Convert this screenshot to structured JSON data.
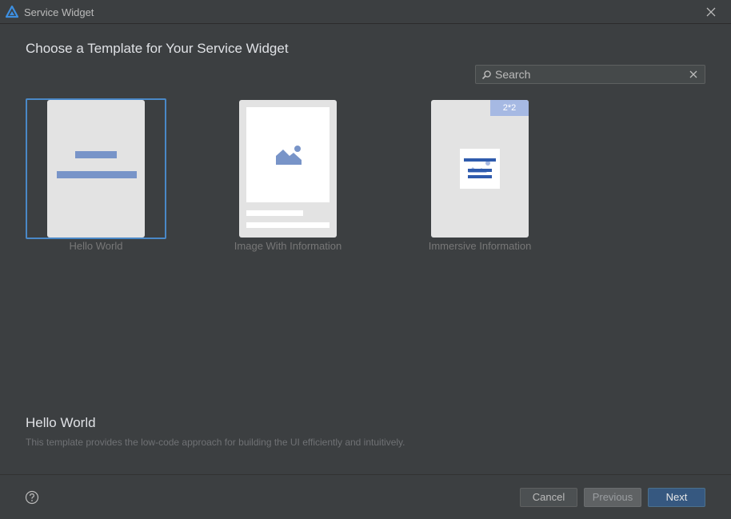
{
  "window": {
    "title": "Service Widget",
    "app_icon": "harmony-logo-icon",
    "close_icon": "close-icon"
  },
  "main": {
    "heading": "Choose a Template for Your Service Widget",
    "search": {
      "placeholder": "Search",
      "value": "",
      "icon": "search-icon",
      "clear_icon": "clear-icon"
    }
  },
  "templates": [
    {
      "label": "Hello World",
      "selected": true
    },
    {
      "label": "Image With Information",
      "selected": false
    },
    {
      "label": "Immersive Information",
      "selected": false,
      "badge": "2*2"
    }
  ],
  "description": {
    "title": "Hello World",
    "text": "This template provides the low-code approach for building the UI efficiently and intuitively."
  },
  "footer": {
    "help_icon": "help-icon",
    "cancel_label": "Cancel",
    "previous_label": "Previous",
    "next_label": "Next"
  },
  "colors": {
    "accent": "#4a88c7",
    "primary_button": "#365880",
    "placeholder_bar": "#7894c8"
  }
}
